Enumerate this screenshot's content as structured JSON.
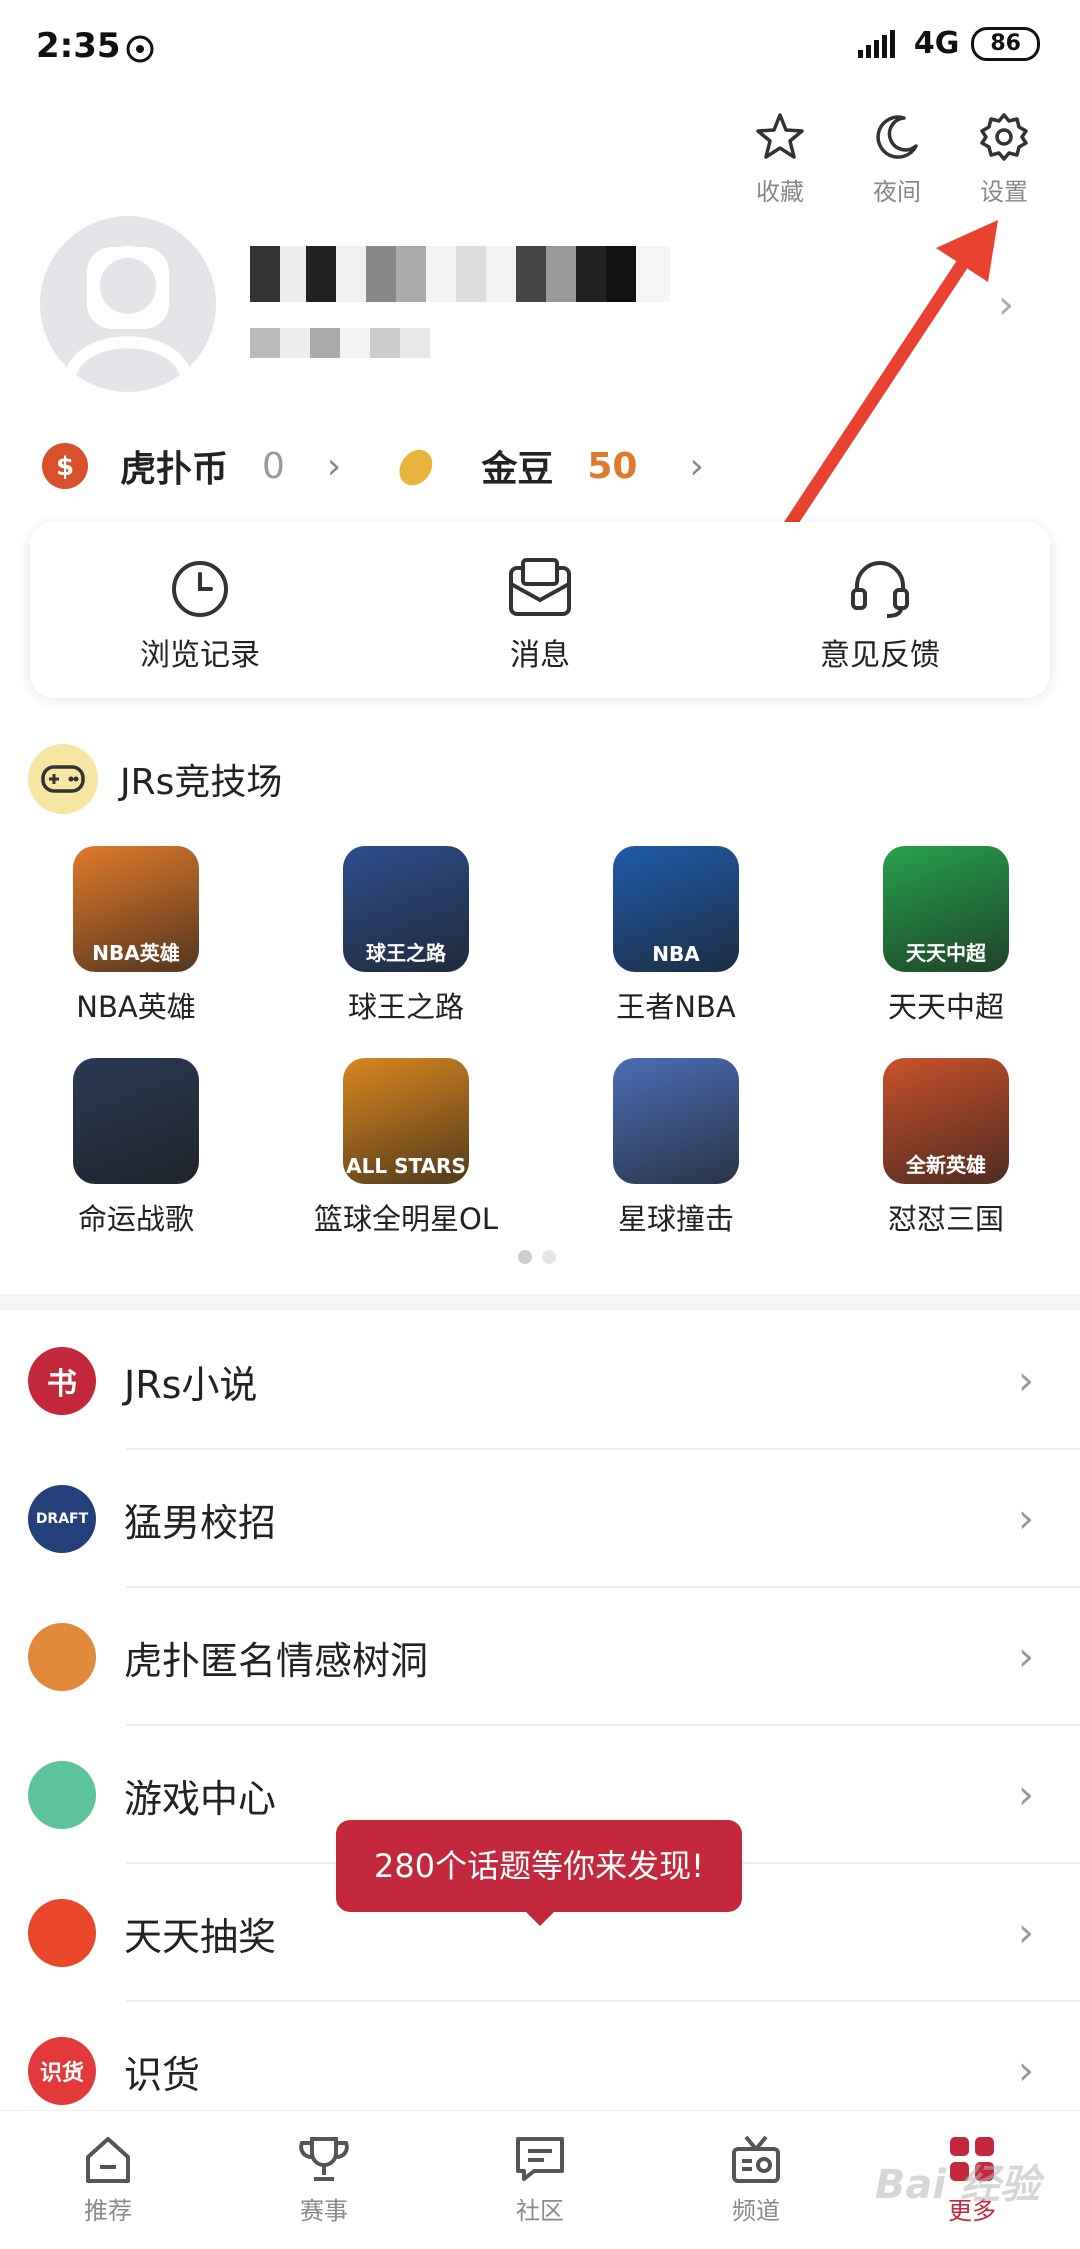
{
  "status_bar": {
    "time": "2:35",
    "network": "4G",
    "battery": "86"
  },
  "top_tools": [
    {
      "label": "收藏",
      "icon": "star-icon"
    },
    {
      "label": "夜间",
      "icon": "moon-icon"
    },
    {
      "label": "设置",
      "icon": "gear-icon"
    }
  ],
  "profile": {
    "name": "",
    "subtitle": ""
  },
  "currency": {
    "coin_label": "虎扑币",
    "coin_value": "0",
    "bean_label": "金豆",
    "bean_value": "50"
  },
  "quick_actions": [
    {
      "label": "浏览记录",
      "icon": "clock-icon"
    },
    {
      "label": "消息",
      "icon": "message-icon"
    },
    {
      "label": "意见反馈",
      "icon": "headset-icon"
    }
  ],
  "arena": {
    "title": "JRs竞技场",
    "games": [
      {
        "label": "NBA英雄",
        "badge": "NBA英雄",
        "color": "#e07a2a"
      },
      {
        "label": "球王之路",
        "badge": "球王之路",
        "color": "#2c4e8c"
      },
      {
        "label": "王者NBA",
        "badge": "NBA",
        "color": "#1f5ba8"
      },
      {
        "label": "天天中超",
        "badge": "天天中超",
        "color": "#27a24b"
      },
      {
        "label": "命运战歌",
        "badge": "",
        "color": "#2a3a55"
      },
      {
        "label": "篮球全明星OL",
        "badge": "ALL STARS",
        "color": "#d9871f"
      },
      {
        "label": "星球撞击",
        "badge": "",
        "color": "#4a6fb5"
      },
      {
        "label": "怼怼三国",
        "badge": "全新英雄",
        "color": "#c9522c"
      }
    ]
  },
  "list": [
    {
      "label": "JRs小说",
      "icon": "book-icon",
      "glyph": "书",
      "color": "#c4283c"
    },
    {
      "label": "猛男校招",
      "icon": "draft-badge-icon",
      "glyph": "DRAFT",
      "color": "#24407a"
    },
    {
      "label": "虎扑匿名情感树洞",
      "icon": "sunglasses-face-icon",
      "glyph": "",
      "color": "#e0893a"
    },
    {
      "label": "游戏中心",
      "icon": "gamepad-icon",
      "glyph": "",
      "color": "#5cc39a"
    },
    {
      "label": "天天抽奖",
      "icon": "gift-icon",
      "glyph": "",
      "color": "#e8472a"
    },
    {
      "label": "识货",
      "icon": "shihuo-icon",
      "glyph": "识货",
      "color": "#e23a3a"
    }
  ],
  "tooltip": "280个话题等你来发现!",
  "bottom_nav": [
    {
      "label": "推荐",
      "icon": "home-icon"
    },
    {
      "label": "赛事",
      "icon": "trophy-icon"
    },
    {
      "label": "社区",
      "icon": "chat-icon"
    },
    {
      "label": "频道",
      "icon": "radio-icon"
    },
    {
      "label": "更多",
      "icon": "grid-icon",
      "active": true
    }
  ],
  "watermark": "Bai 经验",
  "colors": {
    "accent": "#c4283c",
    "bean": "#e07a2a",
    "arrow": "#e8412f"
  }
}
